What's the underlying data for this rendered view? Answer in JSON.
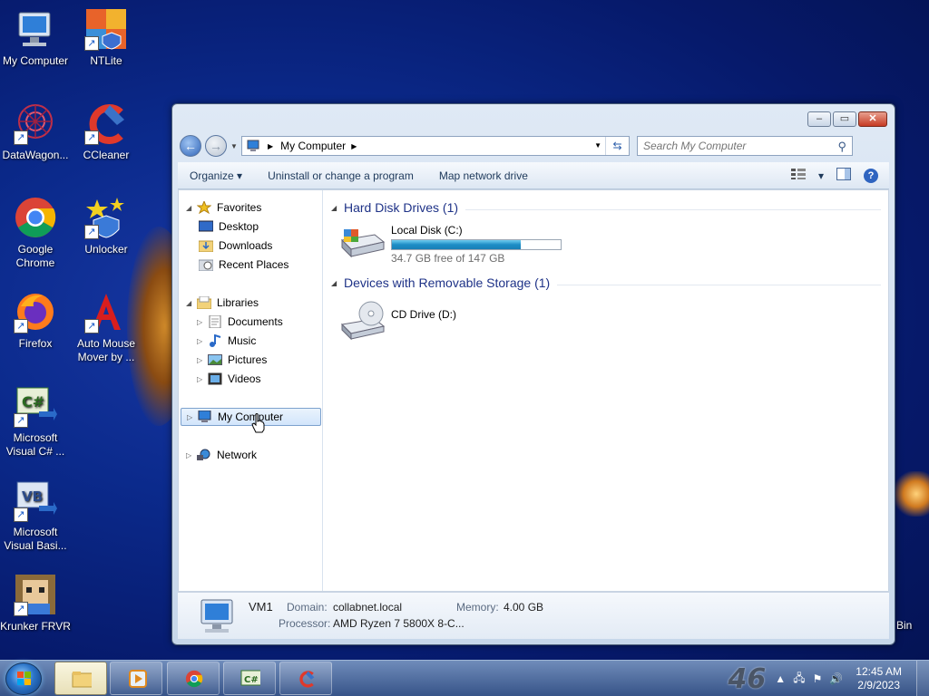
{
  "desktop": {
    "icons": [
      {
        "label": "My Computer"
      },
      {
        "label": "NTLite"
      },
      {
        "label": "DataWagon..."
      },
      {
        "label": "CCleaner"
      },
      {
        "label": "Google Chrome"
      },
      {
        "label": "Unlocker"
      },
      {
        "label": "Firefox"
      },
      {
        "label": "Auto Mouse Mover by ..."
      },
      {
        "label": "Microsoft Visual C# ..."
      },
      {
        "label": "Microsoft Visual Basi..."
      },
      {
        "label": "Krunker FRVR"
      }
    ],
    "partial_label": "Bin"
  },
  "window": {
    "caption": {
      "minimize": "–",
      "maximize": "▭",
      "close": "✕"
    },
    "address": {
      "location": "My Computer"
    },
    "search": {
      "placeholder": "Search My Computer"
    },
    "toolbar": {
      "organize": "Organize ▾",
      "uninstall": "Uninstall or change a program",
      "map_drive": "Map network drive",
      "view_arrow": "▾",
      "help": "?"
    },
    "nav": {
      "favorites": "Favorites",
      "desktop": "Desktop",
      "downloads": "Downloads",
      "recent": "Recent Places",
      "libraries": "Libraries",
      "documents": "Documents",
      "music": "Music",
      "pictures": "Pictures",
      "videos": "Videos",
      "my_computer": "My Computer",
      "network": "Network"
    },
    "main": {
      "hdd_group": "Hard Disk Drives (1)",
      "local_disk": {
        "name": "Local Disk (C:)",
        "free": "34.7 GB free of 147 GB",
        "used_fraction": 0.764
      },
      "removable_group": "Devices with Removable Storage (1)",
      "cd_drive": {
        "name": "CD Drive (D:)"
      }
    },
    "details": {
      "name": "VM1",
      "domain_label": "Domain:",
      "domain": "collabnet.local",
      "memory_label": "Memory:",
      "memory": "4.00 GB",
      "processor_label": "Processor:",
      "processor": "AMD Ryzen 7 5800X 8-C..."
    }
  },
  "taskbar": {
    "overlay_number": "46",
    "time": "12:45 AM",
    "date": "2/9/2023"
  }
}
